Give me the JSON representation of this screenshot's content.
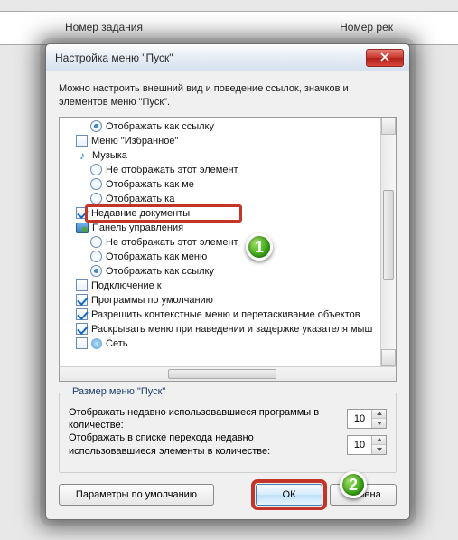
{
  "backdrop": {
    "left": "Номер задания",
    "right": "Номер рек"
  },
  "dialog": {
    "title": "Настройка меню \"Пуск\"",
    "intro": "Можно настроить внешний вид и поведение ссылок, значков и элементов меню \"Пуск\"."
  },
  "tree": {
    "radio_show_link": "Отображать как ссылку",
    "favorites": "Меню \"Избранное\"",
    "music": {
      "label": "Музыка",
      "opt_hide": "Не отображать этот элемент",
      "opt_menu_trunc": "Отображать как ме",
      "opt_link_trunc": "Отображать ка"
    },
    "recent_docs": "Недавние документы",
    "control_panel": {
      "label": "Панель управления",
      "opt_hide": "Не отображать этот элемент",
      "opt_menu": "Отображать как меню",
      "opt_link": "Отображать как ссылку"
    },
    "connect_to": "Подключение к",
    "default_programs": "Программы по умолчанию",
    "context_dnd": "Разрешить контекстные меню и перетаскивание объектов",
    "hover_expand": "Раскрывать меню при наведении и задержке указателя мыш",
    "network": "Сеть"
  },
  "group": {
    "title": "Размер меню \"Пуск\"",
    "programs_label": "Отображать недавно использовавшиеся программы в количестве:",
    "programs_value": "10",
    "jumplist_label": "Отображать в списке перехода недавно использовавшиеся элементы в количестве:",
    "jumplist_value": "10"
  },
  "buttons": {
    "defaults": "Параметры по умолчанию",
    "ok": "ОК",
    "cancel": "Отмена"
  },
  "markers": {
    "one": "1",
    "two": "2"
  }
}
